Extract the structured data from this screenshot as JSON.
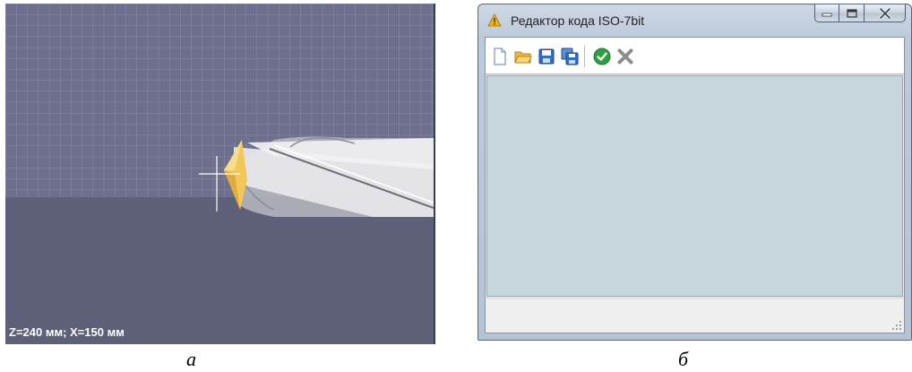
{
  "simulation": {
    "coordinate_readout": "Z=240 мм; X=150 мм",
    "colors": {
      "background": "#5e5f78",
      "grid_line": "#8f92b4",
      "tool_tip": "#f2c75a"
    }
  },
  "captions": {
    "left": "а",
    "right": "б"
  },
  "editor": {
    "title": "Редактор кода ISO-7bit",
    "title_icon": "warning-icon",
    "caption_buttons": {
      "minimize": "minimize-icon",
      "maximize": "maximize-icon",
      "close": "close-icon"
    },
    "toolbar": {
      "new": "new-file-icon",
      "open": "open-folder-icon",
      "save": "save-icon",
      "save_all": "save-all-icon",
      "apply": "check-icon",
      "cancel": "cancel-icon"
    },
    "colors": {
      "code_area": "#c6d6dc",
      "status_bar": "#f0f0f0"
    }
  }
}
